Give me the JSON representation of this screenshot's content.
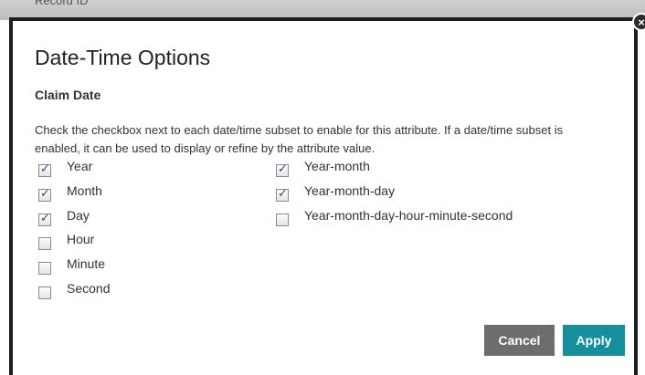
{
  "background": {
    "text": "Record ID"
  },
  "dialog": {
    "close_glyph": "×",
    "title": "Date-Time Options",
    "subtitle": "Claim Date",
    "description": "Check the checkbox next to each date/time subset to enable for this attribute. If a date/time subset is enabled, it can be used to display or refine by the attribute value.",
    "left_options": [
      {
        "label": "Year",
        "checked": true
      },
      {
        "label": "Month",
        "checked": true
      },
      {
        "label": "Day",
        "checked": true
      },
      {
        "label": "Hour",
        "checked": false
      },
      {
        "label": "Minute",
        "checked": false
      },
      {
        "label": "Second",
        "checked": false
      }
    ],
    "right_options": [
      {
        "label": "Year-month",
        "checked": true
      },
      {
        "label": "Year-month-day",
        "checked": true
      },
      {
        "label": "Year-month-day-hour-minute-second",
        "checked": false
      }
    ],
    "cancel_label": "Cancel",
    "apply_label": "Apply"
  },
  "colors": {
    "apply_button": "#148f9b",
    "cancel_button": "#6d6d6d",
    "dialog_border": "#1e1e1e"
  }
}
